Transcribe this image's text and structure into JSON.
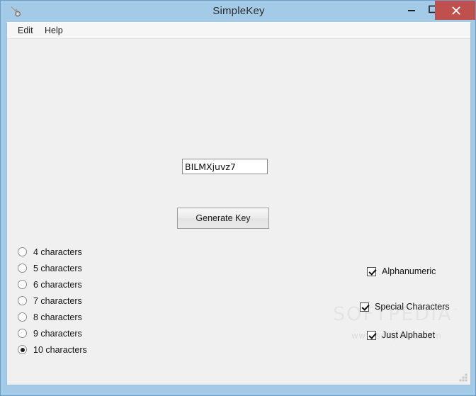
{
  "window": {
    "title": "SimpleKey",
    "icon": "key-icon",
    "frame_color": "#a3cbe8",
    "client_color": "#f0f0f0",
    "controls": {
      "minimize": "Minimize",
      "maximize": "Maximize",
      "close": "Close",
      "close_color": "#c0504d"
    }
  },
  "menubar": {
    "items": [
      {
        "label": "Edit"
      },
      {
        "label": "Help"
      }
    ]
  },
  "main": {
    "key_output": {
      "value": "BILMXjuvz7",
      "placeholder": ""
    },
    "generate_button": {
      "label": "Generate Key"
    },
    "length_options": [
      {
        "label": "4 characters",
        "value": "4",
        "checked": false
      },
      {
        "label": "5 characters",
        "value": "5",
        "checked": false
      },
      {
        "label": "6 characters",
        "value": "6",
        "checked": false
      },
      {
        "label": "7 characters",
        "value": "7",
        "checked": false
      },
      {
        "label": "8 characters",
        "value": "8",
        "checked": false
      },
      {
        "label": "9 characters",
        "value": "9",
        "checked": false
      },
      {
        "label": "10 characters",
        "value": "10",
        "checked": true
      }
    ],
    "charset_options": [
      {
        "label": "Alphanumeric",
        "checked": true
      },
      {
        "label": "Special Characters",
        "checked": true
      },
      {
        "label": "Just Alphabet",
        "checked": true
      }
    ]
  },
  "watermark": {
    "title": "SOFTPEDIA",
    "trademark": "™",
    "url": "www.softpedia.com"
  }
}
